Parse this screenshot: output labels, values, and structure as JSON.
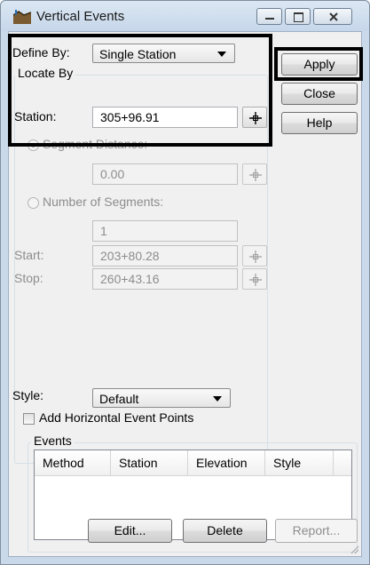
{
  "window": {
    "title": "Vertical Events"
  },
  "define_by": {
    "label": "Define By:",
    "value": "Single Station"
  },
  "locate_by": {
    "title": "Locate By",
    "station_label": "Station:",
    "station_value": "305+96.91",
    "segment_distance_label": "Segment Distance:",
    "segment_distance_value": "0.00",
    "number_of_segments_label": "Number of Segments:",
    "number_of_segments_value": "1",
    "start_label": "Start:",
    "start_value": "203+80.28",
    "stop_label": "Stop:",
    "stop_value": "260+43.16"
  },
  "buttons": {
    "apply": "Apply",
    "close": "Close",
    "help": "Help"
  },
  "style": {
    "label": "Style:",
    "value": "Default"
  },
  "add_horizontal": {
    "label": "Add Horizontal Event Points",
    "checked": false
  },
  "events": {
    "title": "Events",
    "columns": [
      "Method",
      "Station",
      "Elevation",
      "Style"
    ],
    "rows": []
  },
  "event_buttons": {
    "edit": "Edit...",
    "delete": "Delete",
    "report": "Report..."
  },
  "icons": {
    "app": "road-profile-icon",
    "minimize": "minimize-icon",
    "maximize": "maximize-icon",
    "close": "close-icon",
    "pick": "crosshair-pick-icon"
  }
}
